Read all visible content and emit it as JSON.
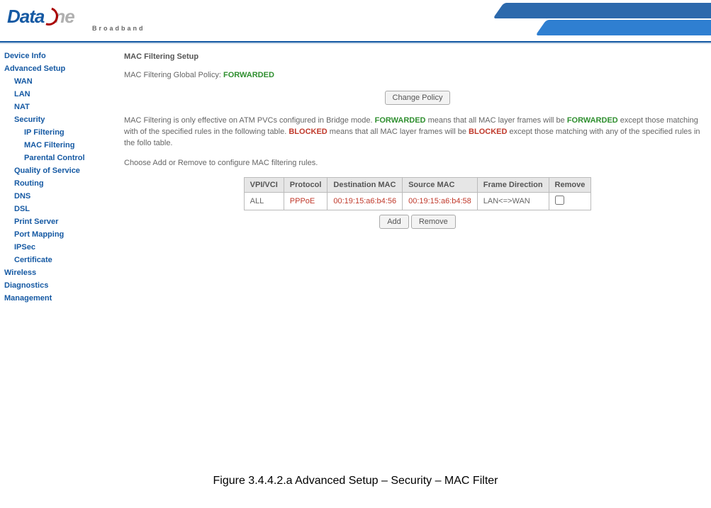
{
  "brand": {
    "part1": "Data",
    "part2": "ne",
    "tagline": "Broadband"
  },
  "nav": {
    "device_info": "Device Info",
    "advanced_setup": "Advanced Setup",
    "wan": "WAN",
    "lan": "LAN",
    "nat": "NAT",
    "security": "Security",
    "ip_filtering": "IP Filtering",
    "mac_filtering": "MAC Filtering",
    "parental_control": "Parental Control",
    "qos": "Quality of Service",
    "routing": "Routing",
    "dns": "DNS",
    "dsl": "DSL",
    "print_server": "Print Server",
    "port_mapping": "Port Mapping",
    "ipsec": "IPSec",
    "certificate": "Certificate",
    "wireless": "Wireless",
    "diagnostics": "Diagnostics",
    "management": "Management"
  },
  "main": {
    "title": "MAC Filtering Setup",
    "policy_label": "MAC Filtering Global Policy: ",
    "policy_value": "FORWARDED",
    "change_policy_btn": "Change Policy",
    "desc_pre": "MAC Filtering is only effective on ATM PVCs configured in Bridge mode. ",
    "desc_fwd": "FORWARDED",
    "desc_mid1": " means that all MAC layer frames will be ",
    "desc_fwd2": "FORWARDED",
    "desc_mid2": " except those matching with of the specified rules in the following table. ",
    "desc_blk": "BLOCKED",
    "desc_mid3": " means that all MAC layer frames will be ",
    "desc_blk2": "BLOCKED",
    "desc_end": " except those matching with any of the specified rules in the follo table.",
    "desc_choose": "Choose Add or Remove to configure MAC filtering rules.",
    "add_btn": "Add",
    "remove_btn": "Remove"
  },
  "table": {
    "headers": {
      "vpi": "VPI/VCI",
      "proto": "Protocol",
      "dmac": "Destination MAC",
      "smac": "Source MAC",
      "dir": "Frame Direction",
      "rem": "Remove"
    },
    "row": {
      "vpi": "ALL",
      "proto": "PPPoE",
      "dmac": "00:19:15:a6:b4:56",
      "smac": "00:19:15:a6:b4:58",
      "dir": "LAN<=>WAN"
    }
  },
  "caption": "Figure 3.4.4.2.a Advanced Setup – Security – MAC Filter"
}
